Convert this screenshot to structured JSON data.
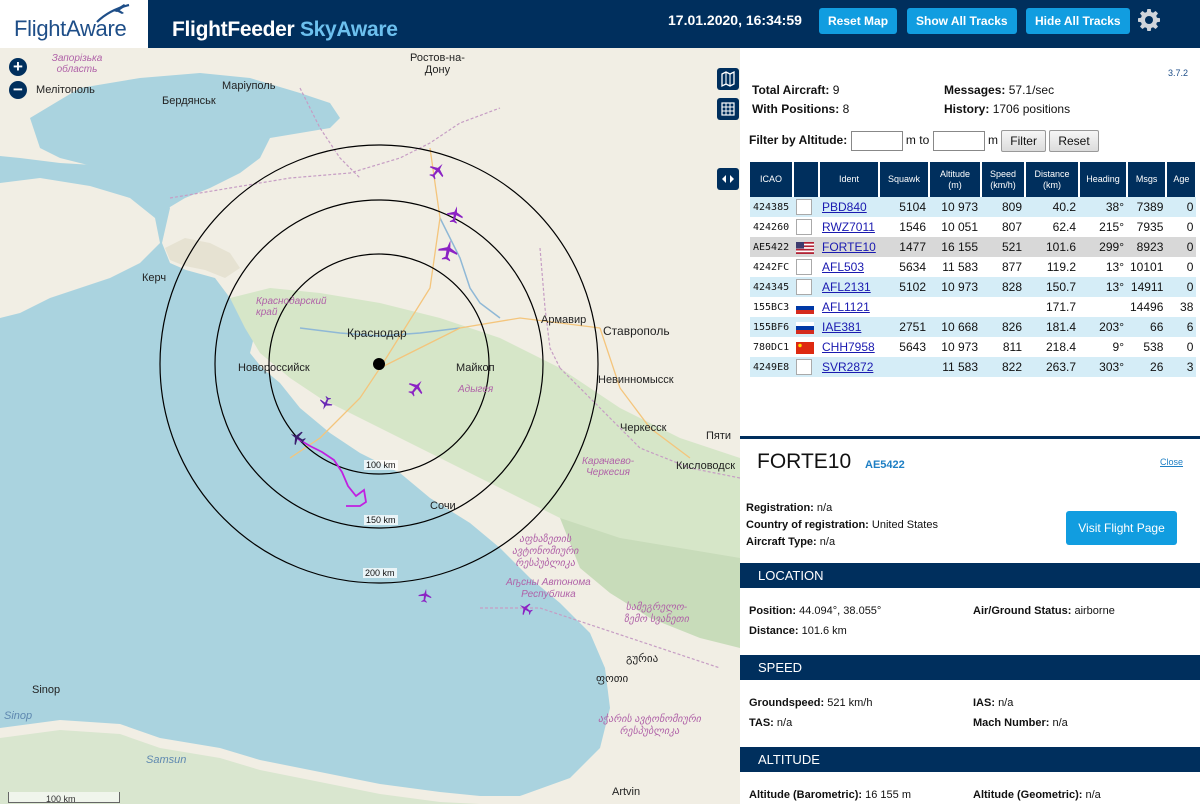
{
  "header": {
    "logo_text": "FlightAware",
    "app_title_main": "FlightFeeder ",
    "app_title_accent": "SkyAware",
    "datetime": "17.01.2020, 16:34:59",
    "buttons": {
      "reset_map": "Reset Map",
      "show_all": "Show All Tracks",
      "hide_all": "Hide All Tracks"
    }
  },
  "map": {
    "labels": {
      "zaporizhzhia_region": "Запорізька\nобласть",
      "melitopol": "Мелітополь",
      "mariupol": "Маріуполь",
      "berdyansk": "Бердянськ",
      "rostov": "Ростов-на-\nДону",
      "kerch": "Керч",
      "krasnodar_krai": "Краснодарский\nкрай",
      "krasnodar": "Краснодар",
      "armavir": "Армавир",
      "stavropol": "Ставрополь",
      "novorossiysk": "Новороссийск",
      "maykop": "Майкоп",
      "adygea": "Адыгея",
      "nevinnomyssk": "Невинномысск",
      "cherkessk": "Черкесск",
      "pyatigorsk": "Пяти",
      "kislovodsk": "Кисловодск",
      "kchr": "Карачаево-\nЧеркесия",
      "sochi": "Сочи",
      "abkhazia_geo": "აფხაზეთის\nავტონომიური\nრესპუბლიკა",
      "abkhazia_ru": "Аҧсны Автонома\nРеспублика",
      "samegrelo": "სამეგრელო-\nზემო სვანეთი",
      "guria": "გურია",
      "poti": "ფოთი",
      "adjara": "აჭარის ავტონომიური\nრესპუბლიკა",
      "sinop_geo": "Sinop",
      "sinop": "Sinop",
      "samsun": "Samsun",
      "artvin": "Artvin"
    },
    "ring_labels": [
      "100 km",
      "150 km",
      "200 km"
    ],
    "scale": "100 km"
  },
  "stats": {
    "total_aircraft_label": "Total Aircraft:",
    "total_aircraft": "9",
    "with_positions_label": "With Positions:",
    "with_positions": "8",
    "messages_label": "Messages:",
    "messages": "57.1/sec",
    "history_label": "History:",
    "history": "1706 positions",
    "version": "3.7.2"
  },
  "filter": {
    "label": "Filter by Altitude:",
    "unit_to": "m to",
    "unit_end": "m",
    "filter_button": "Filter",
    "reset_button": "Reset"
  },
  "table": {
    "columns": [
      "ICAO",
      "",
      "Ident",
      "Squawk",
      "Altitude\n(m)",
      "Speed\n(km/h)",
      "Distance\n(km)",
      "Heading",
      "Msgs",
      "Age"
    ],
    "rows": [
      {
        "icao": "424385",
        "flag": "box",
        "ident": "PBD840",
        "squawk": "5104",
        "altitude": "10 973",
        "speed": "809",
        "distance": "40.2",
        "heading": "38°",
        "msgs": "7389",
        "age": "0"
      },
      {
        "icao": "424260",
        "flag": "box",
        "ident": "RWZ7011",
        "squawk": "1546",
        "altitude": "10 051",
        "speed": "807",
        "distance": "62.4",
        "heading": "215°",
        "msgs": "7935",
        "age": "0"
      },
      {
        "icao": "AE5422",
        "flag": "us",
        "ident": "FORTE10",
        "squawk": "1477",
        "altitude": "16 155",
        "speed": "521",
        "distance": "101.6",
        "heading": "299°",
        "msgs": "8923",
        "age": "0"
      },
      {
        "icao": "4242FC",
        "flag": "box",
        "ident": "AFL503",
        "squawk": "5634",
        "altitude": "11 583",
        "speed": "877",
        "distance": "119.2",
        "heading": "13°",
        "msgs": "10101",
        "age": "0"
      },
      {
        "icao": "424345",
        "flag": "box",
        "ident": "AFL2131",
        "squawk": "5102",
        "altitude": "10 973",
        "speed": "828",
        "distance": "150.7",
        "heading": "13°",
        "msgs": "14911",
        "age": "0"
      },
      {
        "icao": "155BC3",
        "flag": "ru",
        "ident": "AFL1121",
        "squawk": "",
        "altitude": "",
        "speed": "",
        "distance": "171.7",
        "heading": "",
        "msgs": "14496",
        "age": "38"
      },
      {
        "icao": "155BF6",
        "flag": "ru",
        "ident": "IAE381",
        "squawk": "2751",
        "altitude": "10 668",
        "speed": "826",
        "distance": "181.4",
        "heading": "203°",
        "msgs": "66",
        "age": "6"
      },
      {
        "icao": "780DC1",
        "flag": "cn",
        "ident": "CHH7958",
        "squawk": "5643",
        "altitude": "10 973",
        "speed": "811",
        "distance": "218.4",
        "heading": "9°",
        "msgs": "538",
        "age": "0"
      },
      {
        "icao": "4249E8",
        "flag": "box",
        "ident": "SVR2872",
        "squawk": "",
        "altitude": "11 583",
        "speed": "822",
        "distance": "263.7",
        "heading": "303°",
        "msgs": "26",
        "age": "3"
      }
    ]
  },
  "detail": {
    "ident": "FORTE10",
    "icao": "AE5422",
    "close": "Close",
    "registration_label": "Registration:",
    "registration": "n/a",
    "country_label": "Country of registration:",
    "country": "United States",
    "type_label": "Aircraft Type:",
    "type": "n/a",
    "visit_button": "Visit Flight Page",
    "sections": {
      "location": "LOCATION",
      "speed": "SPEED",
      "altitude": "ALTITUDE"
    },
    "position_label": "Position:",
    "position": "44.094°, 38.055°",
    "air_ground_label": "Air/Ground Status:",
    "air_ground": "airborne",
    "distance_label": "Distance:",
    "distance": "101.6 km",
    "groundspeed_label": "Groundspeed:",
    "groundspeed": "521 km/h",
    "ias_label": "IAS:",
    "ias": "n/a",
    "tas_label": "TAS:",
    "tas": "n/a",
    "mach_label": "Mach Number:",
    "mach": "n/a",
    "alt_baro_label": "Altitude (Barometric):",
    "alt_baro": "16 155 m",
    "alt_geom_label": "Altitude (Geometric):",
    "alt_geom": "n/a"
  }
}
